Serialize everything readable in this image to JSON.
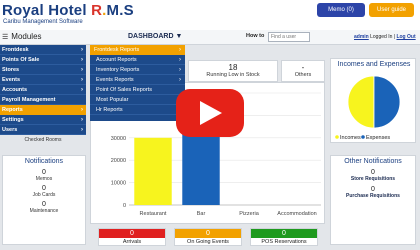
{
  "header": {
    "brand_prefix": "Royal Hotel ",
    "brand_r": "R",
    "brand_dot": ".",
    "brand_rest": "M.S",
    "subtitle": "Caribu Management Software",
    "memo_label": "Memo (0)",
    "guide_label": "User guide"
  },
  "nav": {
    "modules_label": "Modules",
    "modules_icon": "hamburger-icon",
    "dashboard_label": "DASHBOARD",
    "dashboard_chevron": "▼",
    "howto_label": "How to",
    "search_placeholder": "Find a user",
    "user": "admin",
    "logged_text": " Logged In | ",
    "logout": "Log Out"
  },
  "sidebar": {
    "items": [
      {
        "label": "Frontdesk",
        "active": false
      },
      {
        "label": "Points Of Sale",
        "active": false
      },
      {
        "label": "Stores",
        "active": false
      },
      {
        "label": "Events",
        "active": false
      },
      {
        "label": "Accounts",
        "active": false
      },
      {
        "label": "Payroll Management",
        "active": false
      },
      {
        "label": "Reports",
        "active": true
      },
      {
        "label": "Settings",
        "active": false
      },
      {
        "label": "Users",
        "active": false
      }
    ],
    "footer": "Checked Rooms"
  },
  "submenu": {
    "head": "Frontdesk Reports",
    "items": [
      "Account Reports",
      "Inventory Reports",
      "Events Reports",
      "Point Of Sales Reports",
      "Most Popular",
      "Hr Reports"
    ]
  },
  "stats": {
    "low_stock_value": "18",
    "low_stock_label": "Running Low in Stock",
    "others_value": "-",
    "others_label": "Others"
  },
  "chart_data": [
    {
      "type": "bar",
      "categories": [
        "Restaurant",
        "Bar",
        "Pizzeria",
        "Accommodation"
      ],
      "values": [
        30000,
        40000,
        0,
        0
      ],
      "colors": [
        "#f7f41e",
        "#1a63b8",
        "#2ca02c",
        "#d62728"
      ],
      "yticks": [
        "0",
        "10000",
        "20000",
        "30000",
        "40000",
        "50000"
      ],
      "ylim": [
        0,
        50000
      ]
    },
    {
      "type": "pie",
      "title": "Incomes and Expenses",
      "labels": [
        "Incomes",
        "Expenses"
      ],
      "values": [
        50,
        50
      ],
      "colors": [
        "#f7f41e",
        "#1a63b8"
      ]
    }
  ],
  "notifications": {
    "title": "Notifications",
    "items": [
      {
        "value": "0",
        "label": "Memos"
      },
      {
        "value": "0",
        "label": "Job Cards"
      },
      {
        "value": "0",
        "label": "Maintenance"
      }
    ]
  },
  "other_notifications": {
    "title": "Other Notifications",
    "items": [
      {
        "value": "0",
        "label": "Store Requisitions"
      },
      {
        "value": "0",
        "label": "Purchase Requisitions"
      }
    ]
  },
  "tiles": [
    {
      "value": "0",
      "label": "Arrivals",
      "color": "#e02020"
    },
    {
      "value": "0",
      "label": "On Going Events",
      "color": "#f2a100"
    },
    {
      "value": "0",
      "label": "POS Reservations",
      "color": "#1e9a1e"
    }
  ],
  "overlay": {
    "icon": "play-icon"
  }
}
